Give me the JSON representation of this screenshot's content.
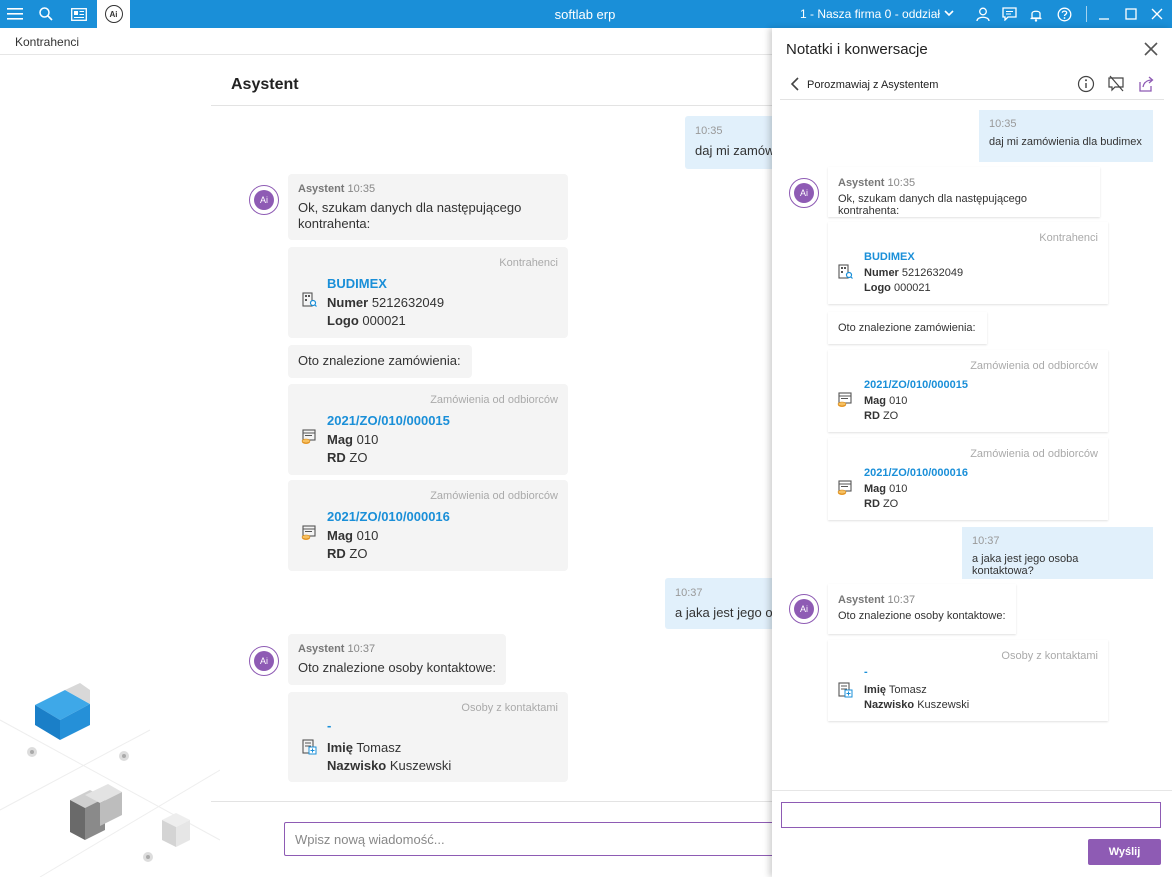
{
  "titlebar": {
    "app_title": "softlab erp",
    "company": "1 - Nasza firma 0 - oddział",
    "ai_tab_label": "Ai",
    "color": "#1a8fd8"
  },
  "breadcrumb": "Kontrahenci",
  "chat": {
    "title": "Asystent",
    "input_placeholder": "Wpisz nową wiadomość...",
    "bot_name": "Asystent",
    "avatar_label": "Ai",
    "user1": {
      "time": "10:35",
      "text": "daj mi zamów"
    },
    "bot1": {
      "time": "10:35",
      "text": "Ok, szukam danych dla następującego kontrahenta:"
    },
    "card_contractor": {
      "type": "Kontrahenci",
      "title": "BUDIMEX",
      "l1_label": "Numer",
      "l1_value": "5212632049",
      "l2_label": "Logo",
      "l2_value": "000021"
    },
    "bot2_text": "Oto znalezione zamówienia:",
    "card_order1": {
      "type": "Zamówienia od odbiorców",
      "title": "2021/ZO/010/000015",
      "l1_label": "Mag",
      "l1_value": "010",
      "l2_label": "RD",
      "l2_value": "ZO"
    },
    "card_order2": {
      "type": "Zamówienia od odbiorców",
      "title": "2021/ZO/010/000016",
      "l1_label": "Mag",
      "l1_value": "010",
      "l2_label": "RD",
      "l2_value": "ZO"
    },
    "user2": {
      "time": "10:37",
      "text": "a jaka jest jego o"
    },
    "bot3": {
      "time": "10:37",
      "text": "Oto znalezione osoby kontaktowe:"
    },
    "card_person": {
      "type": "Osoby z kontaktami",
      "title": "-",
      "l1_label": "Imię",
      "l1_value": "Tomasz",
      "l2_label": "Nazwisko",
      "l2_value": "Kuszewski"
    }
  },
  "panel": {
    "title": "Notatki i konwersacje",
    "subhead": "Porozmawiaj z Asystentem",
    "send_label": "Wyślij",
    "accent": "#8e5bb4",
    "user1": {
      "time": "10:35",
      "text": "daj mi zamówienia dla budimex"
    },
    "bot1": {
      "time": "10:35",
      "text": "Ok, szukam danych dla następującego kontrahenta:"
    },
    "card_contractor": {
      "type": "Kontrahenci",
      "title": "BUDIMEX",
      "l1_label": "Numer",
      "l1_value": "5212632049",
      "l2_label": "Logo",
      "l2_value": "000021"
    },
    "bot2_text": "Oto znalezione zamówienia:",
    "card_order1": {
      "type": "Zamówienia od odbiorców",
      "title": "2021/ZO/010/000015",
      "l1_label": "Mag",
      "l1_value": "010",
      "l2_label": "RD",
      "l2_value": "ZO"
    },
    "card_order2": {
      "type": "Zamówienia od odbiorców",
      "title": "2021/ZO/010/000016",
      "l1_label": "Mag",
      "l1_value": "010",
      "l2_label": "RD",
      "l2_value": "ZO"
    },
    "user2": {
      "time": "10:37",
      "text": "a jaka jest jego osoba kontaktowa?"
    },
    "bot3": {
      "time": "10:37",
      "text": "Oto znalezione osoby kontaktowe:"
    },
    "card_person": {
      "type": "Osoby z kontaktami",
      "title": "-",
      "l1_label": "Imię",
      "l1_value": "Tomasz",
      "l2_label": "Nazwisko",
      "l2_value": "Kuszewski"
    }
  }
}
